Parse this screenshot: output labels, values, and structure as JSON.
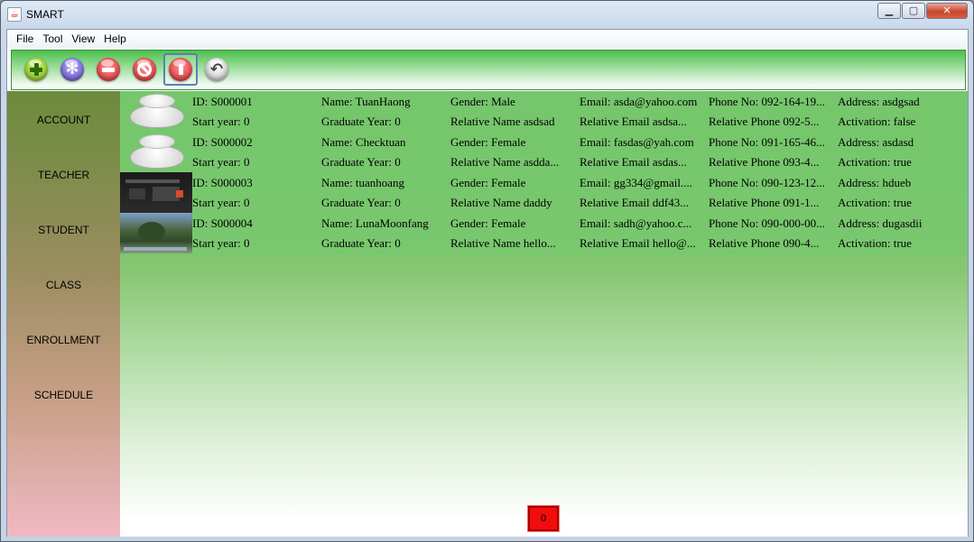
{
  "window": {
    "title": "SMART",
    "icon": "java-cup-icon",
    "controls": [
      "minimize-icon",
      "maximize-icon",
      "close-icon"
    ]
  },
  "menu": [
    "File",
    "Tool",
    "View",
    "Help"
  ],
  "toolbar": [
    {
      "name": "add",
      "icon": "plus-icon",
      "color": "#8dc63f"
    },
    {
      "name": "settings",
      "icon": "gear-icon",
      "color": "#7b6ee0"
    },
    {
      "name": "remove",
      "icon": "minus-icon",
      "color": "#e03a3a"
    },
    {
      "name": "block",
      "icon": "no-entry-icon",
      "color": "#e03a3a"
    },
    {
      "name": "alert",
      "icon": "exclamation-icon",
      "color": "#e03a3a",
      "selected": true
    },
    {
      "name": "undo",
      "icon": "undo-icon",
      "color": "#d0d0d0"
    }
  ],
  "sidebar": [
    "ACCOUNT",
    "TEACHER",
    "STUDENT",
    "CLASS",
    "ENROLLMENT",
    "SCHEDULE"
  ],
  "records": [
    {
      "thumbnail": "default-avatar",
      "row1": [
        "ID: S000001",
        "Name: TuanHaong",
        "Gender: Male",
        "Email: asda@yahoo.com",
        "Phone No: 092-164-19...",
        "Address: asdgsad"
      ],
      "row2": [
        "Start year: 0",
        "Graduate Year: 0",
        "Relative Name asdsad",
        "Relative Email asdsa...",
        "Relative Phone 092-5...",
        "Activation: false"
      ]
    },
    {
      "thumbnail": "default-avatar",
      "row1": [
        "ID: S000002",
        "Name: Checktuan",
        "Gender: Female",
        "Email: fasdas@yah.com",
        "Phone No: 091-165-46...",
        "Address: asdasd"
      ],
      "row2": [
        "Start year: 0",
        "Graduate Year: 0",
        "Relative Name asdda...",
        "Relative Email asdas...",
        "Relative Phone 093-4...",
        "Activation: true"
      ]
    },
    {
      "thumbnail": "screenshot-dark",
      "row1": [
        "ID: S000003",
        "Name: tuanhoang",
        "Gender: Female",
        "Email: gg334@gmail....",
        "Phone No: 090-123-12...",
        "Address: hdueb"
      ],
      "row2": [
        "Start year: 0",
        "Graduate Year: 0",
        "Relative Name daddy",
        "Relative Email ddf43...",
        "Relative Phone 091-1...",
        "Activation: true"
      ]
    },
    {
      "thumbnail": "screenshot-game",
      "row1": [
        "ID: S000004",
        "Name: LunaMoonfang",
        "Gender: Female",
        "Email: sadh@yahoo.c...",
        "Phone No: 090-000-00...",
        "Address: dugasdii"
      ],
      "row2": [
        "Start year: 0",
        "Graduate Year: 0",
        "Relative Name hello...",
        "Relative Email hello@...",
        "Relative Phone 090-4...",
        "Activation: true"
      ]
    }
  ],
  "status_badge": "0",
  "colors": {
    "toolbar_green": "#5fc35c",
    "sidebar_top": "#6b8b3c",
    "sidebar_bottom": "#f0b9c3",
    "badge_red": "#f20d0d"
  }
}
